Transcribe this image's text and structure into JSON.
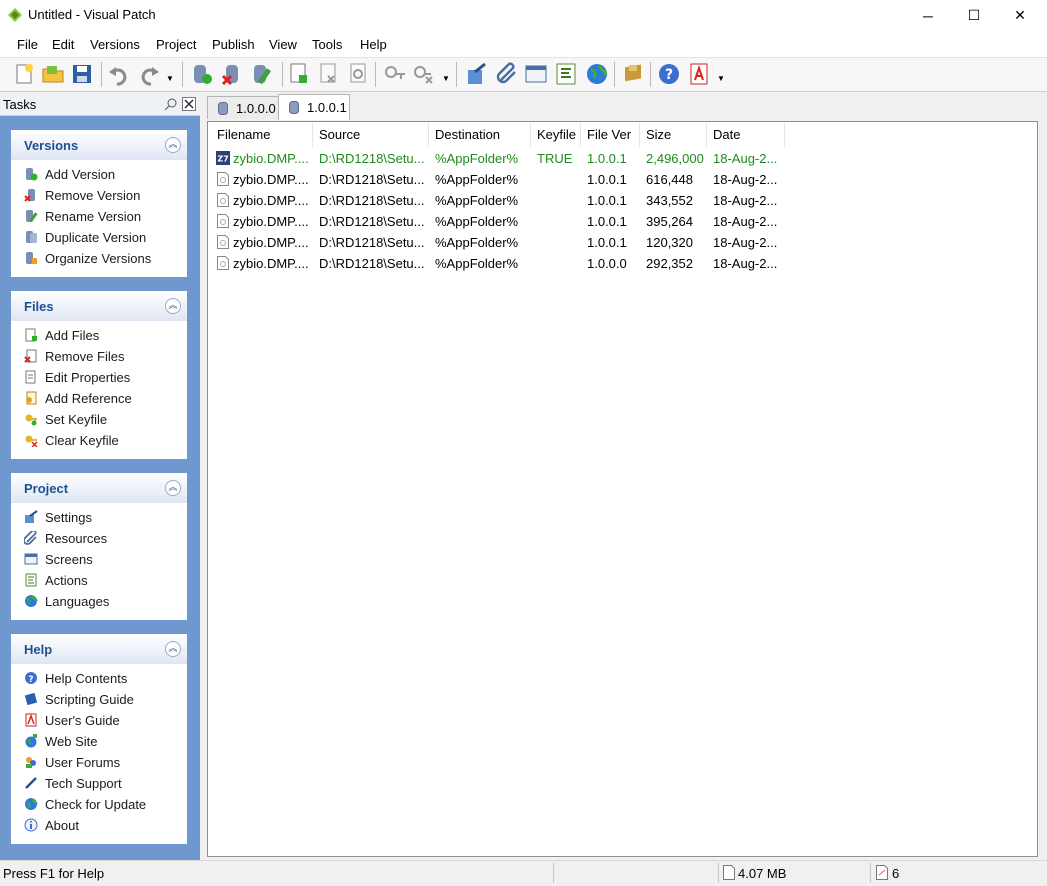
{
  "window": {
    "title": "Untitled - Visual Patch",
    "controls": {
      "minimize": "─",
      "maximize": "☐",
      "close": "✕"
    }
  },
  "menu": [
    "File",
    "Edit",
    "Versions",
    "Project",
    "Publish",
    "View",
    "Tools",
    "Help"
  ],
  "toolbar": {
    "groups": [
      [
        "new-project-icon",
        "open-project-icon",
        "save-icon",
        "undo-icon",
        "redo-icon"
      ],
      [
        "add-version-icon",
        "remove-version-icon",
        "rename-version-icon"
      ],
      [
        "add-files-icon",
        "remove-files-icon",
        "file-properties-icon",
        "set-keyfile-icon",
        "clear-keyfile-icon"
      ],
      [
        "settings-icon",
        "resources-icon",
        "screens-icon",
        "actions-icon",
        "languages-icon"
      ],
      [
        "publish-icon",
        "help-icon",
        "users-guide-icon"
      ]
    ]
  },
  "tasks": {
    "title": "Tasks",
    "groups": [
      {
        "title": "Versions",
        "items": [
          "Add Version",
          "Remove Version",
          "Rename Version",
          "Duplicate Version",
          "Organize Versions"
        ]
      },
      {
        "title": "Files",
        "items": [
          "Add Files",
          "Remove Files",
          "Edit Properties",
          "Add Reference",
          "Set Keyfile",
          "Clear Keyfile"
        ]
      },
      {
        "title": "Project",
        "items": [
          "Settings",
          "Resources",
          "Screens",
          "Actions",
          "Languages"
        ]
      },
      {
        "title": "Help",
        "items": [
          "Help Contents",
          "Scripting Guide",
          "User's Guide",
          "Web Site",
          "User Forums",
          "Tech Support",
          "Check for Update",
          "About"
        ]
      }
    ]
  },
  "tabs": [
    {
      "label": "1.0.0.0",
      "active": false
    },
    {
      "label": "1.0.0.1",
      "active": true
    }
  ],
  "table": {
    "columns": [
      "Filename",
      "Source",
      "Destination",
      "Keyfile",
      "File Ver",
      "Size",
      "Date"
    ],
    "rows": [
      {
        "filename": "zybio.DMP....",
        "source": "D:\\RD1218\\Setu...",
        "destination": "%AppFolder%",
        "keyfile": "TRUE",
        "filever": "1.0.0.1",
        "size": "2,496,000",
        "date": "18-Aug-2...",
        "highlight": true
      },
      {
        "filename": "zybio.DMP....",
        "source": "D:\\RD1218\\Setu...",
        "destination": "%AppFolder%",
        "keyfile": "",
        "filever": "1.0.0.1",
        "size": "616,448",
        "date": "18-Aug-2...",
        "highlight": false
      },
      {
        "filename": "zybio.DMP....",
        "source": "D:\\RD1218\\Setu...",
        "destination": "%AppFolder%",
        "keyfile": "",
        "filever": "1.0.0.1",
        "size": "343,552",
        "date": "18-Aug-2...",
        "highlight": false
      },
      {
        "filename": "zybio.DMP....",
        "source": "D:\\RD1218\\Setu...",
        "destination": "%AppFolder%",
        "keyfile": "",
        "filever": "1.0.0.1",
        "size": "395,264",
        "date": "18-Aug-2...",
        "highlight": false
      },
      {
        "filename": "zybio.DMP....",
        "source": "D:\\RD1218\\Setu...",
        "destination": "%AppFolder%",
        "keyfile": "",
        "filever": "1.0.0.1",
        "size": "120,320",
        "date": "18-Aug-2...",
        "highlight": false
      },
      {
        "filename": "zybio.DMP....",
        "source": "D:\\RD1218\\Setu...",
        "destination": "%AppFolder%",
        "keyfile": "",
        "filever": "1.0.0.0",
        "size": "292,352",
        "date": "18-Aug-2...",
        "highlight": false
      }
    ]
  },
  "status": {
    "help_text": "Press F1 for Help",
    "size": "4.07 MB",
    "count": "6"
  },
  "colors": {
    "accent": "#1f4f92",
    "keyfile_row": "#1f8a1f",
    "panel_bg": "#6f98cf"
  }
}
